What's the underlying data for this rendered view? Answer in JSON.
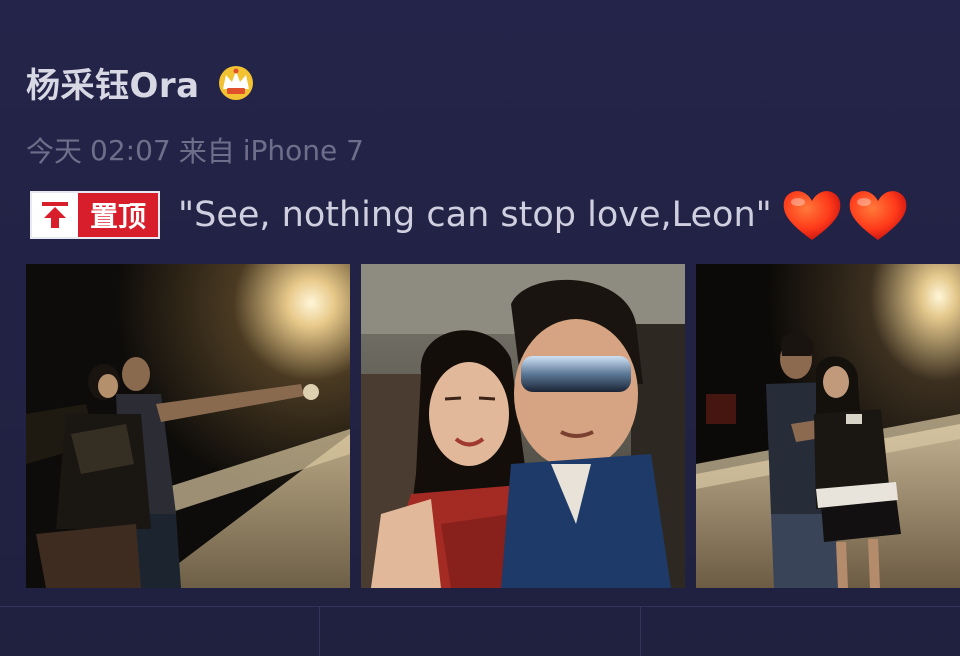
{
  "post": {
    "username": "杨采钰Ora",
    "badge_icon": "crown-badge-icon",
    "meta": {
      "day": "今天",
      "time": "02:07",
      "source_prefix": "来自",
      "device": "iPhone 7"
    },
    "pinned_label": "置顶",
    "pinned_icon": "pin-to-top-icon",
    "text": "\"See, nothing can stop love,Leon\"",
    "emoji": [
      "heart-icon",
      "heart-icon"
    ],
    "photos": [
      {
        "name": "photo-1",
        "description_icon": "photo-icon"
      },
      {
        "name": "photo-2",
        "description_icon": "photo-icon"
      },
      {
        "name": "photo-3",
        "description_icon": "photo-icon"
      }
    ]
  },
  "colors": {
    "background": "#232348",
    "username": "#d8d8e4",
    "meta": "#6e6e8a",
    "pin_red": "#d81e2a",
    "heart": "#ff3a1a"
  }
}
